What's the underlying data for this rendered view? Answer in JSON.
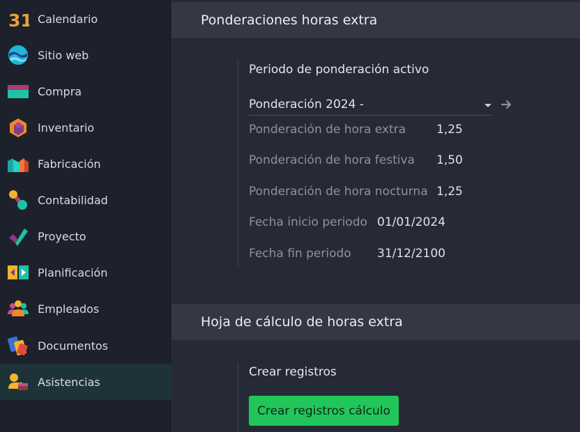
{
  "sidebar": {
    "items": [
      {
        "label": "Calendario",
        "icon": "calendar-icon"
      },
      {
        "label": "Sitio web",
        "icon": "website-icon"
      },
      {
        "label": "Compra",
        "icon": "purchase-icon"
      },
      {
        "label": "Inventario",
        "icon": "inventory-icon"
      },
      {
        "label": "Fabricación",
        "icon": "manufacturing-icon"
      },
      {
        "label": "Contabilidad",
        "icon": "accounting-icon"
      },
      {
        "label": "Proyecto",
        "icon": "project-icon"
      },
      {
        "label": "Planificación",
        "icon": "planning-icon"
      },
      {
        "label": "Empleados",
        "icon": "employees-icon"
      },
      {
        "label": "Documentos",
        "icon": "documents-icon"
      },
      {
        "label": "Asistencias",
        "icon": "attendances-icon",
        "active": true
      }
    ],
    "calendar_icon_text": "31"
  },
  "weights_section": {
    "title": "Ponderaciones horas extra",
    "subtitle": "Periodo de ponderación activo",
    "period_select": {
      "value": "Ponderación 2024 -"
    },
    "fields": [
      {
        "label": "Ponderación de hora extra",
        "value": "1,25"
      },
      {
        "label": "Ponderación de hora festiva",
        "value": "1,50"
      },
      {
        "label": "Ponderación de hora nocturna",
        "value": "1,25"
      },
      {
        "label": "Fecha inicio periodo",
        "value": "01/01/2024"
      },
      {
        "label": "Fecha fin periodo",
        "value": "31/12/2100"
      }
    ]
  },
  "sheet_section": {
    "title": "Hoja de cálculo de horas extra",
    "subtitle": "Crear registros",
    "button_label": "Crear registros cálculo"
  },
  "colors": {
    "accent_green": "#21c65a",
    "active_item_bg": "#1e3338",
    "header_bg": "#343845"
  }
}
